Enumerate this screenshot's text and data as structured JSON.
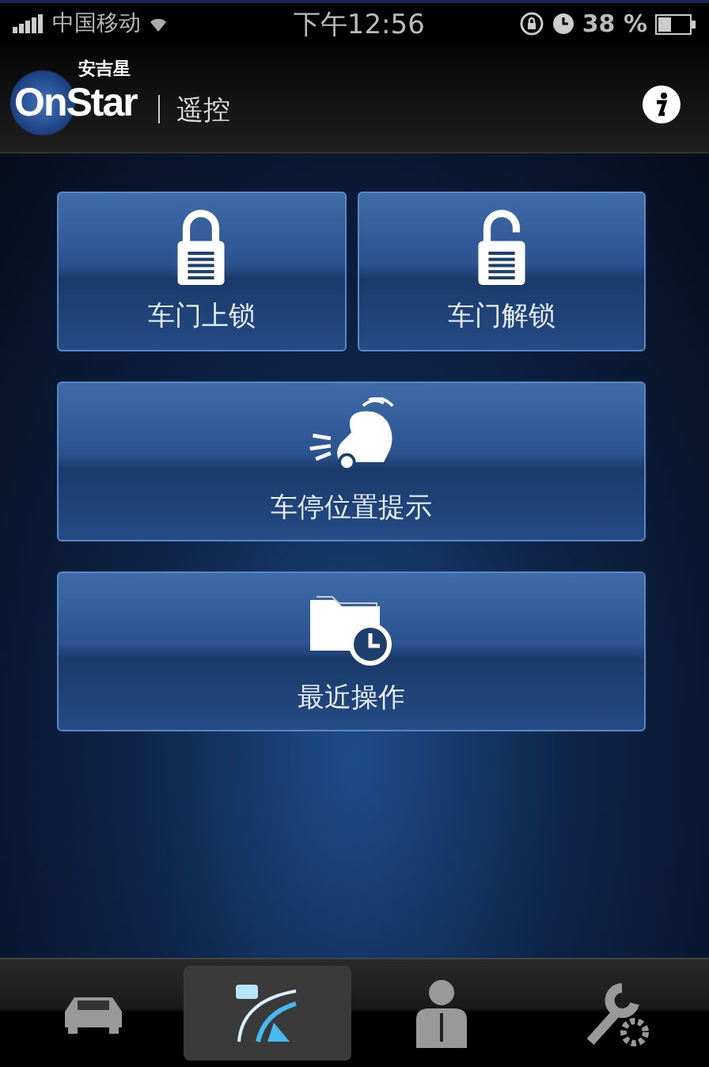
{
  "status_bar": {
    "carrier": "中国移动",
    "time": "下午12:56",
    "battery": "38 %"
  },
  "header": {
    "logo_text": "OnStar",
    "logo_cn": "安吉星",
    "title": "遥控"
  },
  "actions": [
    {
      "label": "车门上锁",
      "kind": "lock"
    },
    {
      "label": "车门解锁",
      "kind": "unlock"
    },
    {
      "label": "车停位置提示",
      "kind": "locate"
    },
    {
      "label": "最近操作",
      "kind": "history"
    }
  ],
  "tab_bar": [
    {
      "kind": "car",
      "selected": false
    },
    {
      "kind": "road",
      "selected": true
    },
    {
      "kind": "advisor",
      "selected": false
    },
    {
      "kind": "settings",
      "selected": false
    }
  ]
}
